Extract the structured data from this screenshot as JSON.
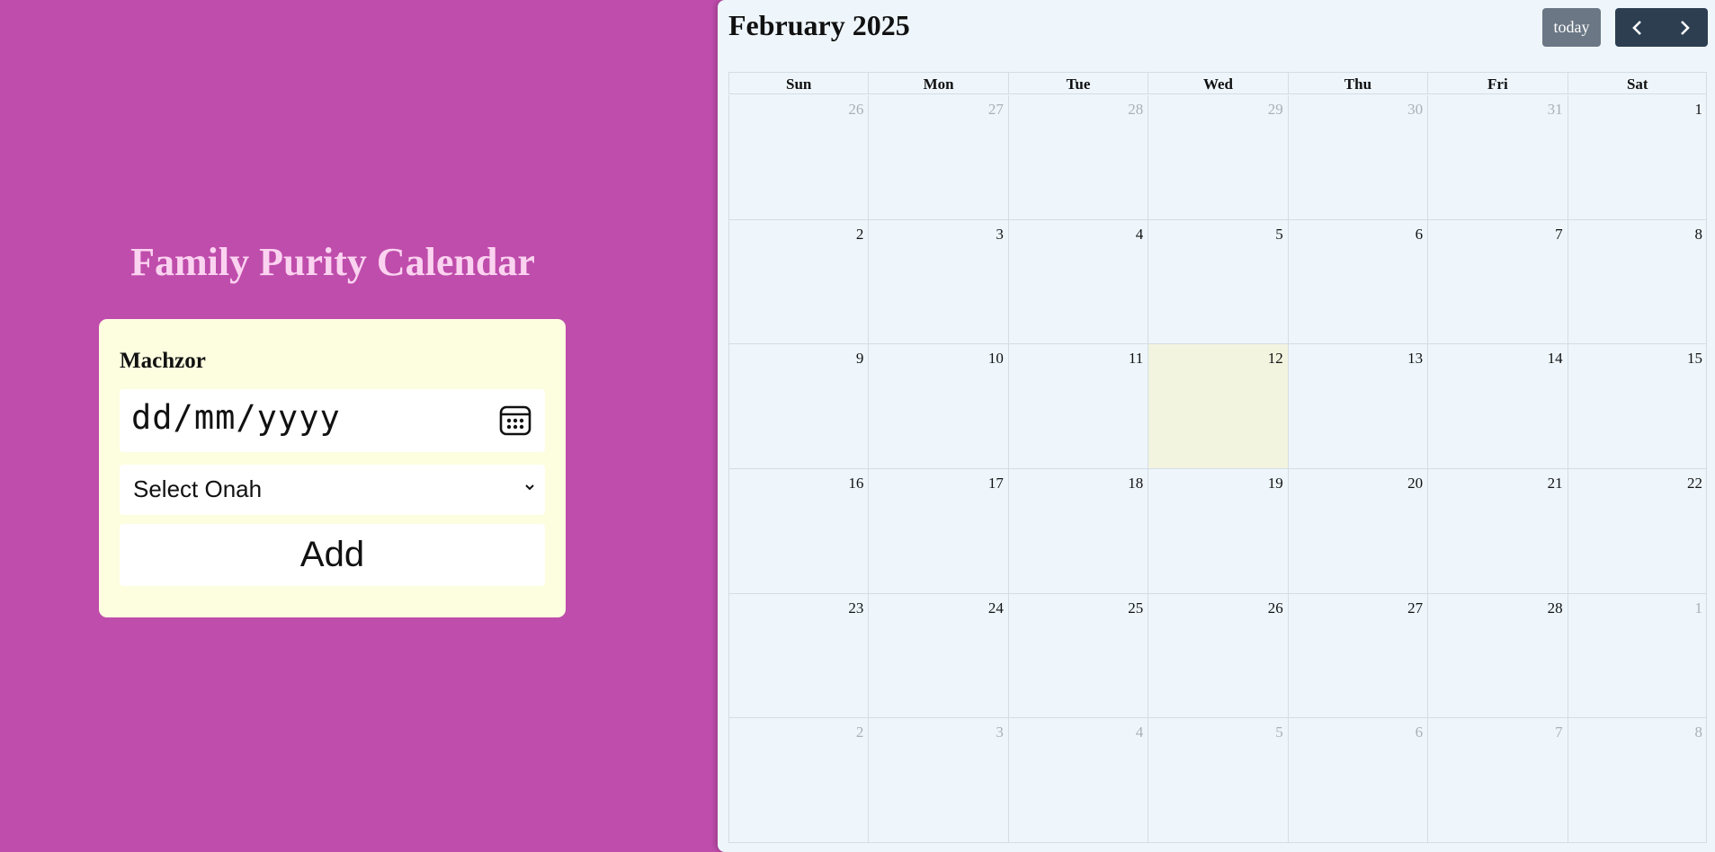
{
  "app": {
    "title": "Family Purity Calendar"
  },
  "form": {
    "section_label": "Machzor",
    "date_placeholder": "dd/mm/yyyy",
    "onah_selected": "Select Onah",
    "add_label": "Add"
  },
  "calendar": {
    "title": "February 2025",
    "today_label": "today",
    "weekdays": [
      "Sun",
      "Mon",
      "Tue",
      "Wed",
      "Thu",
      "Fri",
      "Sat"
    ],
    "weeks": [
      [
        {
          "d": "26",
          "o": true
        },
        {
          "d": "27",
          "o": true
        },
        {
          "d": "28",
          "o": true
        },
        {
          "d": "29",
          "o": true
        },
        {
          "d": "30",
          "o": true
        },
        {
          "d": "31",
          "o": true
        },
        {
          "d": "1",
          "o": false
        }
      ],
      [
        {
          "d": "2",
          "o": false
        },
        {
          "d": "3",
          "o": false
        },
        {
          "d": "4",
          "o": false
        },
        {
          "d": "5",
          "o": false
        },
        {
          "d": "6",
          "o": false
        },
        {
          "d": "7",
          "o": false
        },
        {
          "d": "8",
          "o": false
        }
      ],
      [
        {
          "d": "9",
          "o": false
        },
        {
          "d": "10",
          "o": false
        },
        {
          "d": "11",
          "o": false
        },
        {
          "d": "12",
          "o": false,
          "today": true
        },
        {
          "d": "13",
          "o": false
        },
        {
          "d": "14",
          "o": false
        },
        {
          "d": "15",
          "o": false
        }
      ],
      [
        {
          "d": "16",
          "o": false
        },
        {
          "d": "17",
          "o": false
        },
        {
          "d": "18",
          "o": false
        },
        {
          "d": "19",
          "o": false
        },
        {
          "d": "20",
          "o": false
        },
        {
          "d": "21",
          "o": false
        },
        {
          "d": "22",
          "o": false
        }
      ],
      [
        {
          "d": "23",
          "o": false
        },
        {
          "d": "24",
          "o": false
        },
        {
          "d": "25",
          "o": false
        },
        {
          "d": "26",
          "o": false
        },
        {
          "d": "27",
          "o": false
        },
        {
          "d": "28",
          "o": false
        },
        {
          "d": "1",
          "o": true
        }
      ],
      [
        {
          "d": "2",
          "o": true
        },
        {
          "d": "3",
          "o": true
        },
        {
          "d": "4",
          "o": true
        },
        {
          "d": "5",
          "o": true
        },
        {
          "d": "6",
          "o": true
        },
        {
          "d": "7",
          "o": true
        },
        {
          "d": "8",
          "o": true
        }
      ]
    ]
  },
  "colors": {
    "background": "#bf4dac",
    "title": "#fbd3f0",
    "card": "#fdfde0",
    "calendar_bg": "#eef6fc",
    "today_cell": "#f3f4df",
    "nav_dark": "#2c3e50",
    "today_button": "#6b7785"
  },
  "icons": {
    "date_picker": "calendar-icon",
    "select_arrow": "chevron-down-icon",
    "prev": "chevron-left-icon",
    "next": "chevron-right-icon"
  }
}
